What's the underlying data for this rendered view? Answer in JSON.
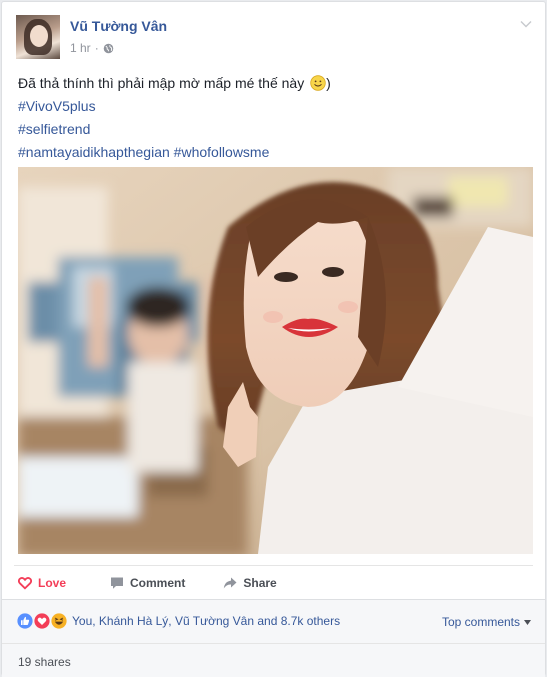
{
  "post": {
    "author": "Vũ Tường Vân",
    "time": "1 hr",
    "separator": "·",
    "text": "Đã thả thính thì phải mập mờ mấp mé thế này",
    "text_suffix": ")",
    "hashtags": [
      "#VivoV5plus",
      "#selfietrend",
      "#namtayaidikhapthegian #whofollowsme"
    ],
    "photo_icon": "selfie-photo"
  },
  "actions": {
    "love": "Love",
    "comment": "Comment",
    "share": "Share"
  },
  "reactions": {
    "icons": [
      "like-icon",
      "love-icon",
      "haha-icon"
    ],
    "summary": "You, Khánh Hà Lý, Vũ Tường Vân and 8.7k others",
    "top_comments": "Top comments"
  },
  "shares": {
    "text": "19 shares"
  },
  "colors": {
    "link": "#365899",
    "love": "#f33e58",
    "like": "#5890ff",
    "haha": "#f7b125"
  }
}
